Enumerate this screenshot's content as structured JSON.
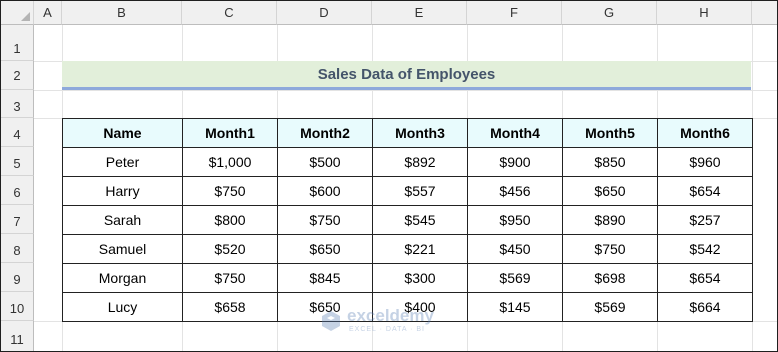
{
  "columns": [
    "A",
    "B",
    "C",
    "D",
    "E",
    "F",
    "G",
    "H"
  ],
  "rows": [
    "1",
    "2",
    "3",
    "4",
    "5",
    "6",
    "7",
    "8",
    "9",
    "10",
    "11"
  ],
  "title": "Sales Data of Employees",
  "table": {
    "headers": [
      "Name",
      "Month1",
      "Month2",
      "Month3",
      "Month4",
      "Month5",
      "Month6"
    ],
    "rows": [
      [
        "Peter",
        "$1,000",
        "$500",
        "$892",
        "$900",
        "$850",
        "$960"
      ],
      [
        "Harry",
        "$750",
        "$600",
        "$557",
        "$456",
        "$650",
        "$654"
      ],
      [
        "Sarah",
        "$800",
        "$750",
        "$545",
        "$950",
        "$890",
        "$257"
      ],
      [
        "Samuel",
        "$520",
        "$650",
        "$221",
        "$450",
        "$750",
        "$542"
      ],
      [
        "Morgan",
        "$750",
        "$845",
        "$300",
        "$569",
        "$698",
        "$654"
      ],
      [
        "Lucy",
        "$658",
        "$650",
        "$400",
        "$145",
        "$569",
        "$664"
      ]
    ]
  },
  "watermark": {
    "brand": "exceldemy",
    "tagline": "EXCEL · DATA · BI",
    "icon": "exceldemy-logo-icon"
  },
  "colors": {
    "title_fill": "#e2efda",
    "title_text": "#44546a",
    "title_underline": "#8ea9db",
    "header_fill": "#e8fbfd"
  }
}
